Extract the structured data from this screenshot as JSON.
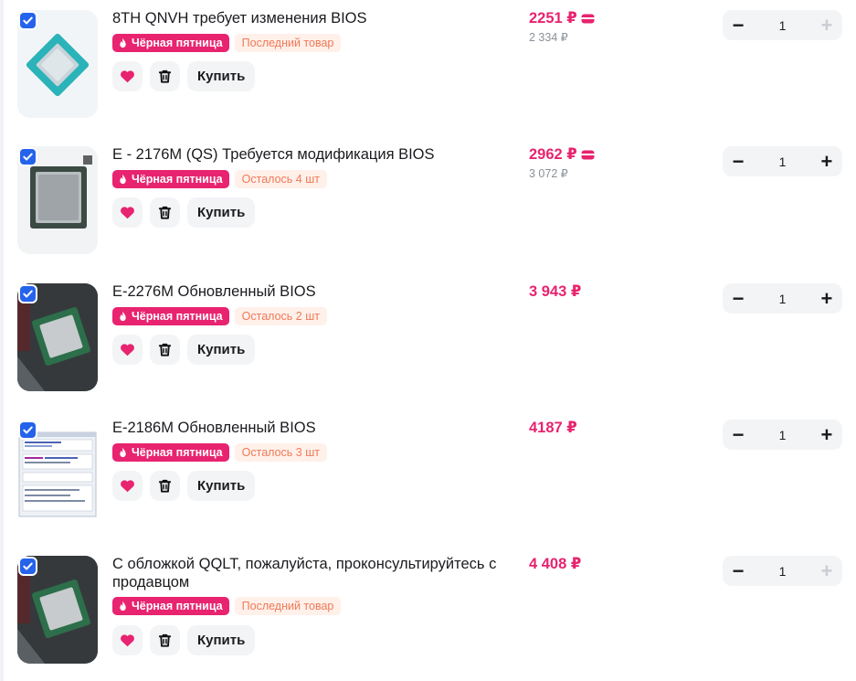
{
  "colors": {
    "accent": "#e8236f",
    "checkbox": "#2563eb",
    "stock_text": "#f07a57",
    "stock_bg": "#fff0ea",
    "muted": "#8a8f98"
  },
  "icons": {
    "checkbox": "check-icon",
    "badge": "flame-icon",
    "favorite": "heart-icon",
    "delete": "trash-icon",
    "price_card": "card-icon",
    "decrement": "minus-icon",
    "increment": "plus-icon"
  },
  "items": [
    {
      "title": "8TH QNVH требует изменения BIOS",
      "badge": "Чёрная пятница",
      "stock": "Последний товар",
      "price": "2251 ₽",
      "old_price": "2 334 ₽",
      "has_card_icon": true,
      "quantity": "1",
      "plus_enabled": false,
      "buy_label": "Купить",
      "minus": "−",
      "plus": "+"
    },
    {
      "title": "E - 2176M (QS) Требуется модификация BIOS",
      "badge": "Чёрная пятница",
      "stock": "Осталось 4 шт",
      "price": "2962 ₽",
      "old_price": "3 072 ₽",
      "has_card_icon": true,
      "quantity": "1",
      "plus_enabled": true,
      "buy_label": "Купить",
      "minus": "−",
      "plus": "+"
    },
    {
      "title": "E-2276M Обновленный BIOS",
      "badge": "Чёрная пятница",
      "stock": "Осталось 2 шт",
      "price": "3 943 ₽",
      "old_price": "",
      "has_card_icon": false,
      "quantity": "1",
      "plus_enabled": true,
      "buy_label": "Купить",
      "minus": "−",
      "plus": "+"
    },
    {
      "title": "E-2186M Обновленный BIOS",
      "badge": "Чёрная пятница",
      "stock": "Осталось 3 шт",
      "price": "4187 ₽",
      "old_price": "",
      "has_card_icon": false,
      "quantity": "1",
      "plus_enabled": true,
      "buy_label": "Купить",
      "minus": "−",
      "plus": "+"
    },
    {
      "title": "С обложкой QQLT, пожалуйста, проконсультируйтесь с продавцом",
      "badge": "Чёрная пятница",
      "stock": "Последний товар",
      "price": "4 408 ₽",
      "old_price": "",
      "has_card_icon": false,
      "quantity": "1",
      "plus_enabled": false,
      "buy_label": "Купить",
      "minus": "−",
      "plus": "+"
    }
  ]
}
